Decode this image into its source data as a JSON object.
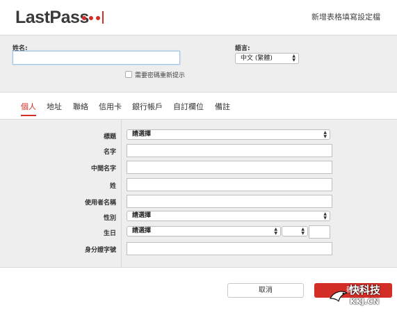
{
  "header": {
    "logo": "LastPass",
    "title": "新增表格填寫設定檔"
  },
  "profile": {
    "name_label": "姓名:",
    "name_value": "",
    "language_label": "語言:",
    "language_value": "中文 (繁體)",
    "reprompt_label": "需要密碼重新提示"
  },
  "tabs": [
    {
      "label": "個人"
    },
    {
      "label": "地址"
    },
    {
      "label": "聯絡"
    },
    {
      "label": "信用卡"
    },
    {
      "label": "銀行帳戶"
    },
    {
      "label": "自訂欄位"
    },
    {
      "label": "備註"
    }
  ],
  "form": {
    "title_label": "標題",
    "title_value": "請選擇",
    "first_name_label": "名字",
    "middle_name_label": "中間名字",
    "last_name_label": "姓",
    "username_label": "使用者名稱",
    "gender_label": "性別",
    "gender_value": "請選擇",
    "birthday_label": "生日",
    "birthday_month_value": "請選擇",
    "id_label": "身分證字號"
  },
  "footer": {
    "cancel_label": "取消",
    "add_label": "新增"
  },
  "watermark": {
    "text": "快科技",
    "url": "KKJ.CN"
  },
  "colors": {
    "accent": "#d32d27",
    "panel_bg": "#eeeeee"
  }
}
